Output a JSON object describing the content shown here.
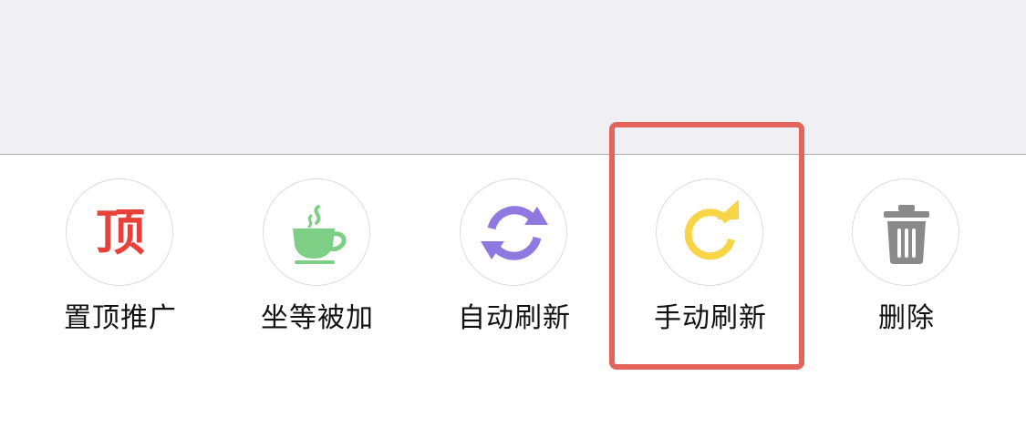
{
  "actions": [
    {
      "id": "pin",
      "label": "置顶推广",
      "icon": "pin-top-icon",
      "glyph": "顶",
      "color": "#e8413a"
    },
    {
      "id": "sit",
      "label": "坐等被加",
      "icon": "coffee-cup-icon",
      "color": "#7dcf85"
    },
    {
      "id": "auto-refresh",
      "label": "自动刷新",
      "icon": "sync-arrows-icon",
      "color": "#8f78e0"
    },
    {
      "id": "manual-refresh",
      "label": "手动刷新",
      "icon": "refresh-icon",
      "color": "#f8d447"
    },
    {
      "id": "delete",
      "label": "删除",
      "icon": "trash-icon",
      "color": "#8a8a8a"
    }
  ],
  "highlight": {
    "target": "manual-refresh",
    "color": "#e4645b"
  }
}
